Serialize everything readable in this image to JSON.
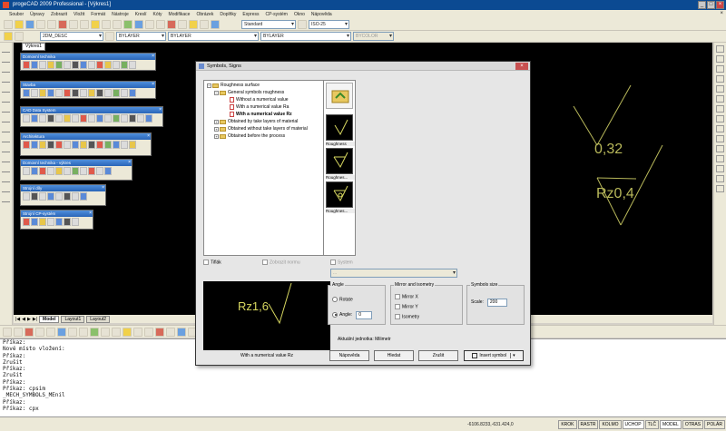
{
  "window": {
    "title": "progeCAD 2009 Professional - [Výkres1]"
  },
  "menubar": {
    "items": [
      "Soubor",
      "Úpravy",
      "Zobrazit",
      "Vložit",
      "Formát",
      "Nástroje",
      "Kreslí",
      "Kóty",
      "Modifikace",
      "Obrázek",
      "Doplňky",
      "Express",
      "CP-systém",
      "Okno",
      "Nápověda"
    ]
  },
  "toolbar1": {
    "layer_value": "2DM_DESC",
    "bylayer_color": "BYLAYER",
    "bylayer_linetype": "BYLAYER",
    "bylayer_lineweight": "BYLAYER",
    "bycolor": "BYCOLOR",
    "textstyle": "Standard",
    "dimstyle": "ISO-25"
  },
  "document_tab": "Výkres1",
  "palettes": [
    {
      "title": "Domovní technika"
    },
    {
      "title": "Stavba"
    },
    {
      "title": "CAD Data System"
    },
    {
      "title": "Architektura"
    },
    {
      "title": "Domovní technika - výkres"
    },
    {
      "title": "Strojní díly"
    },
    {
      "title": "Strojní CP-systém"
    }
  ],
  "drawing": {
    "annotations": [
      "0,32",
      "Rz0,4"
    ]
  },
  "layout_tabs": [
    "Model",
    "Layout1",
    "Layout2"
  ],
  "console": {
    "lines": [
      "Příkaz:",
      "Nové místo vložení:",
      "Příkaz:",
      "Zrušit",
      "Příkaz:",
      "Zrušit",
      "Příkaz:",
      "Příkaz: cpsim",
      "_MECH_SYMBOLS_MEnil",
      "Příkaz:",
      "Příkaz: cpx"
    ]
  },
  "statusbar": {
    "coords": "-6106.8233,-631.424,0",
    "buttons": [
      "KROK",
      "RASTR",
      "KOLMO",
      "UCHOP",
      "TLČ",
      "MODEL",
      "OTRAS",
      "POLÁR"
    ]
  },
  "dialog": {
    "title": "Symbols, Signs",
    "tree": {
      "root": "Roughness surface",
      "general": "General symbols roughness",
      "items": [
        "Without a numerical value",
        "With a numerical value Ra",
        "With a numerical value Rz"
      ],
      "others": [
        "Obtained by take layers of material",
        "Obtained without take layers of material",
        "Obtained before the process"
      ]
    },
    "thumbs": [
      "",
      "Roughness",
      "Roughnes...",
      "Roughnes..."
    ],
    "preview": {
      "top_label": "Tiflák",
      "zobrazit": "Zobrazit normu",
      "text": "Rz1,6",
      "caption": "With a numerical value Rz"
    },
    "system_label": "System",
    "system_value": "...",
    "angle": {
      "title": "Angle",
      "rotate": "Rotate",
      "angle": "Angle:",
      "angle_value": "0"
    },
    "mirror": {
      "title": "Mirror and isometry",
      "x": "Mirror X",
      "y": "Mirror Y",
      "iso": "Isometry"
    },
    "size": {
      "title": "Symbols size",
      "scale": "Scale:",
      "scale_value": "200"
    },
    "units": "Aktuální jednotka: Milimetr",
    "buttons": {
      "help": "Nápověda",
      "find": "Hledat",
      "cancel": "Zrušit",
      "insert": "Insert symbol"
    }
  }
}
